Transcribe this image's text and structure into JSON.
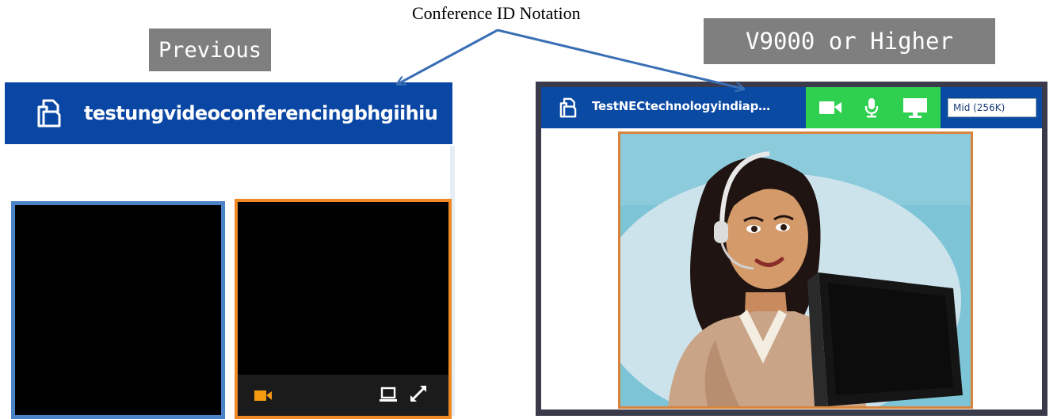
{
  "annotation": {
    "title": "Conference ID Notation",
    "label_previous": "Previous",
    "label_new": "V9000 or Higher",
    "arrow_color": "#3a6fb5"
  },
  "previous": {
    "conference_id": "testungvideoconferencingbhgiihiu",
    "header_color": "#0a47a4",
    "tile_1_border_color": "#4a83c6",
    "tile_2_border_color": "#f08a24",
    "toolbar_icons": [
      "camera-icon",
      "screen-share-icon",
      "expand-icon"
    ]
  },
  "new": {
    "conference_id": "TestNECtechnologyindiap…",
    "header_color": "#0b4aa3",
    "controls_color": "#2fcf4f",
    "controls": [
      "video-camera-icon",
      "microphone-icon",
      "monitor-icon"
    ],
    "bandwidth": "Mid (256K)",
    "video_border_color": "#d9843c"
  }
}
